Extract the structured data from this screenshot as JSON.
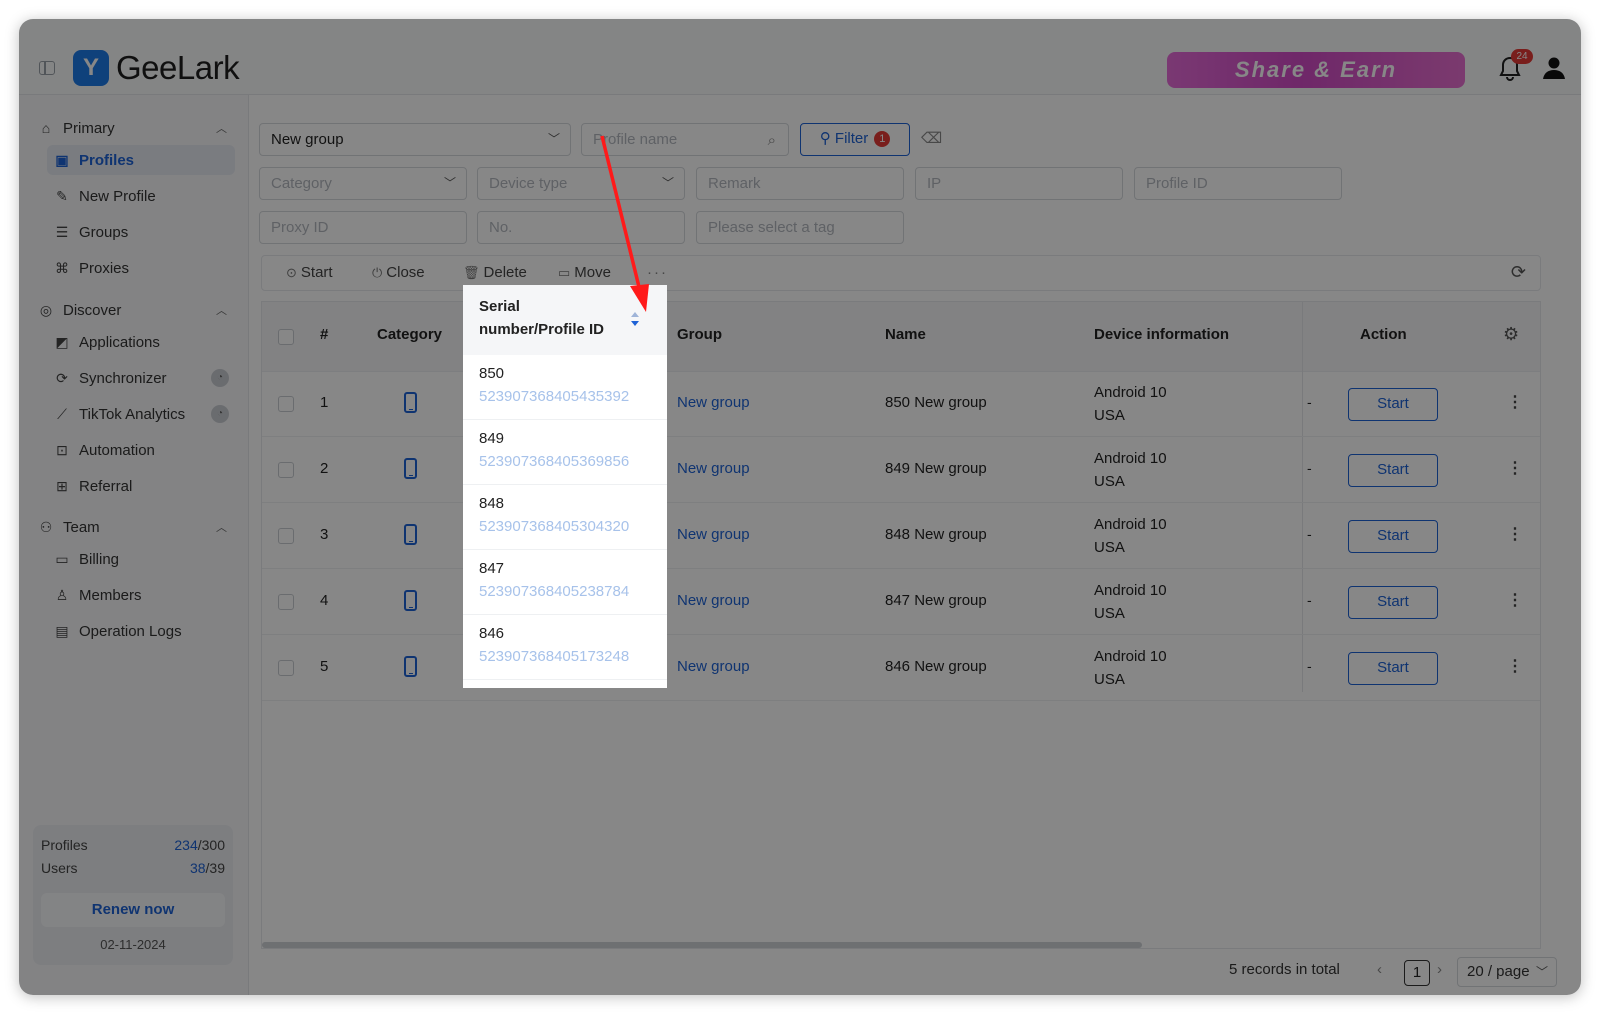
{
  "app": {
    "name": "GeeLark",
    "logo_glyph": "Y"
  },
  "header": {
    "share_banner": "Share & Earn",
    "notification_count": "24"
  },
  "sidebar": {
    "sections": [
      {
        "label": "Primary",
        "icon": "home-icon"
      },
      {
        "label": "Discover",
        "icon": "compass-icon"
      },
      {
        "label": "Team",
        "icon": "team-icon"
      }
    ],
    "items": [
      {
        "label": "Profiles",
        "icon": "profiles-icon",
        "active": true
      },
      {
        "label": "New Profile",
        "icon": "edit-icon"
      },
      {
        "label": "Groups",
        "icon": "list-icon"
      },
      {
        "label": "Proxies",
        "icon": "proxy-icon"
      },
      {
        "label": "Applications",
        "icon": "apps-icon"
      },
      {
        "label": "Synchronizer",
        "icon": "sync-icon"
      },
      {
        "label": "TikTok Analytics",
        "icon": "chart-icon"
      },
      {
        "label": "Automation",
        "icon": "automation-icon"
      },
      {
        "label": "Referral",
        "icon": "gift-icon"
      },
      {
        "label": "Billing",
        "icon": "billing-icon"
      },
      {
        "label": "Members",
        "icon": "members-icon"
      },
      {
        "label": "Operation Logs",
        "icon": "logs-icon"
      }
    ],
    "quota": {
      "profiles_label": "Profiles",
      "profiles_used": "234",
      "profiles_total": "/300",
      "users_label": "Users",
      "users_used": "38",
      "users_total": "/39",
      "renew_label": "Renew now",
      "date": "02-11-2024"
    }
  },
  "filters": {
    "group_value": "New group",
    "profile_name_placeholder": "Profile name",
    "filter_label": "Filter",
    "filter_count": "1",
    "category_placeholder": "Category",
    "device_type_placeholder": "Device type",
    "remark_placeholder": "Remark",
    "ip_placeholder": "IP",
    "profile_id_placeholder": "Profile ID",
    "proxy_id_placeholder": "Proxy ID",
    "no_placeholder": "No.",
    "tag_placeholder": "Please select a tag"
  },
  "toolbar": {
    "start": "Start",
    "close": "Close",
    "delete": "Delete",
    "move": "Move",
    "more": "···"
  },
  "table": {
    "headers": {
      "index": "#",
      "category": "Category",
      "serial": "Serial number/Profile ID",
      "group": "Group",
      "name": "Name",
      "device": "Device information",
      "action": "Action"
    },
    "rows": [
      {
        "index": "1",
        "serial": "850",
        "profile_id": "523907368405435392",
        "group": "New group",
        "name": "850 New group",
        "os": "Android 10",
        "region": "USA",
        "extra": "-",
        "action": "Start"
      },
      {
        "index": "2",
        "serial": "849",
        "profile_id": "523907368405369856",
        "group": "New group",
        "name": "849 New group",
        "os": "Android 10",
        "region": "USA",
        "extra": "-",
        "action": "Start"
      },
      {
        "index": "3",
        "serial": "848",
        "profile_id": "523907368405304320",
        "group": "New group",
        "name": "848 New group",
        "os": "Android 10",
        "region": "USA",
        "extra": "-",
        "action": "Start"
      },
      {
        "index": "4",
        "serial": "847",
        "profile_id": "523907368405238784",
        "group": "New group",
        "name": "847 New group",
        "os": "Android 10",
        "region": "USA",
        "extra": "-",
        "action": "Start"
      },
      {
        "index": "5",
        "serial": "846",
        "profile_id": "523907368405173248",
        "group": "New group",
        "name": "846 New group",
        "os": "Android 10",
        "region": "USA",
        "extra": "-",
        "action": "Start"
      }
    ]
  },
  "pagination": {
    "total": "5 records in total",
    "current_page": "1",
    "page_size": "20 / page"
  },
  "colors": {
    "accent": "#1e62d6",
    "badge": "#e53935",
    "annotation_arrow": "#ff1a1a"
  }
}
